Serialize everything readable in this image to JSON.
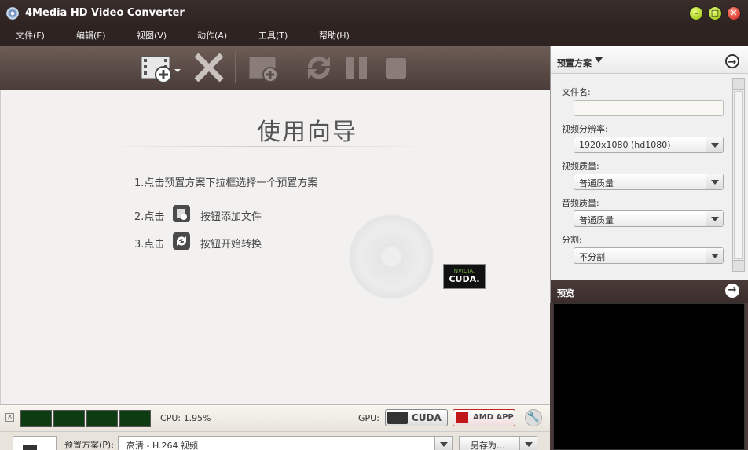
{
  "window": {
    "title": "4Media HD Video Converter",
    "min_label": "–",
    "max_label": "□",
    "close_label": "✕"
  },
  "menu": {
    "items": [
      "文件(F)",
      "编辑(E)",
      "视图(V)",
      "动作(A)",
      "工具(T)",
      "帮助(H)"
    ]
  },
  "toolbar": {
    "icons": [
      "add-video-icon",
      "delete-icon",
      "add-segment-icon",
      "convert-icon",
      "pause-icon",
      "stop-icon"
    ]
  },
  "wizard": {
    "title": "使用向导",
    "step1": "1.点击预置方案下拉框选择一个预置方案",
    "step2_prefix": "2.点击",
    "step2_suffix": "按钮添加文件",
    "step3_prefix": "3.点击",
    "step3_suffix": "按钮开始转换",
    "cuda_top": "NVIDIA.",
    "cuda_bottom": "CUDA."
  },
  "status": {
    "cpu_label": "CPU: 1.95%",
    "gpu_label": "GPU:",
    "cuda_button": "CUDA",
    "amd_button": "AMD APP"
  },
  "profile_bar": {
    "label": "预置方案(P):",
    "value": "高清 - H.264 视频",
    "save_as": "另存为..."
  },
  "right_panel": {
    "header": "预置方案",
    "filename_label": "文件名:",
    "filename_value": "",
    "resolution_label": "视频分辨率:",
    "resolution_value": "1920x1080 (hd1080)",
    "video_quality_label": "视频质量:",
    "video_quality_value": "普通质量",
    "audio_quality_label": "音频质量:",
    "audio_quality_value": "普通质量",
    "split_label": "分割:",
    "split_value": "不分割"
  },
  "preview": {
    "header": "预览"
  },
  "colors": {
    "accent_green": "#8fb800",
    "close_red": "#d0140a",
    "dark_bar": "#2e2321"
  }
}
